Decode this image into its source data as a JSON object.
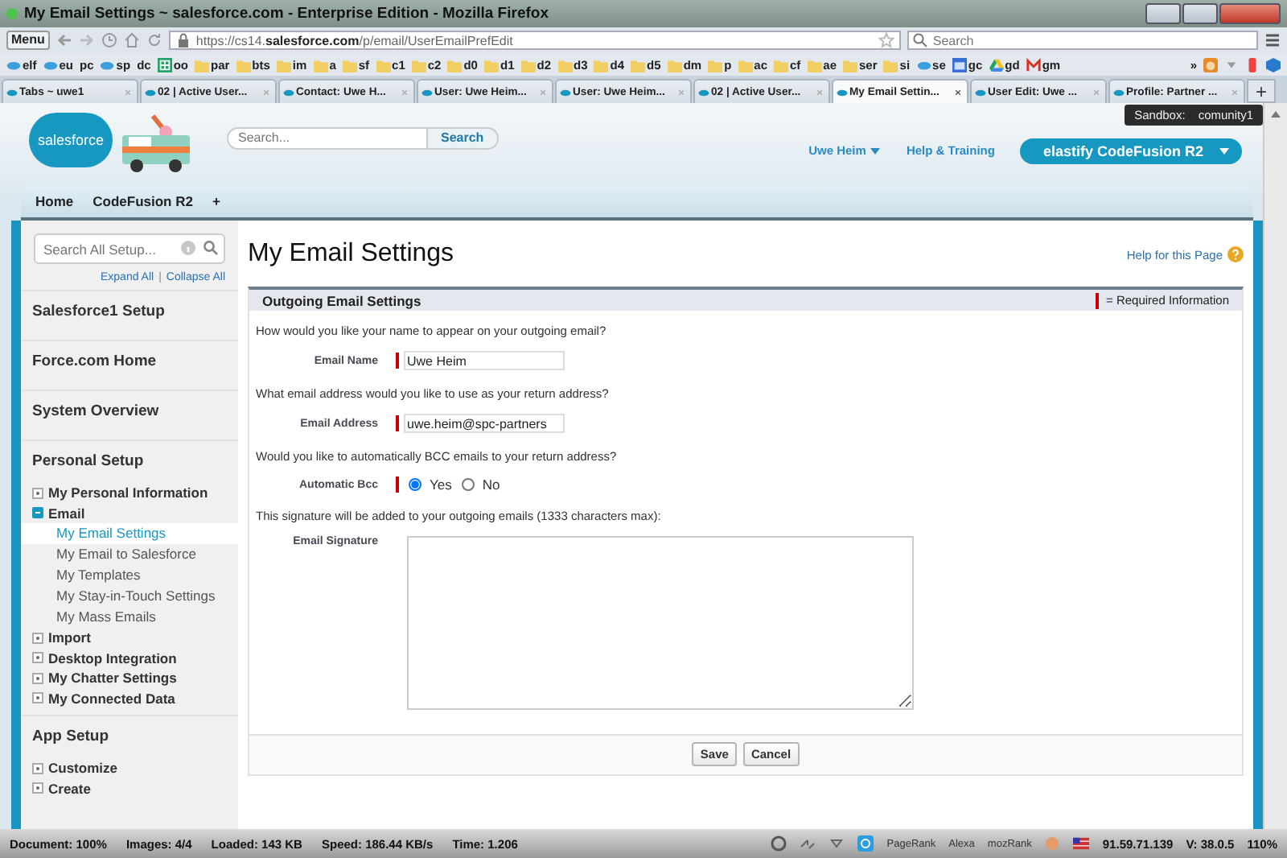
{
  "window": {
    "title": "My Email Settings ~ salesforce.com - Enterprise Edition - Mozilla Firefox"
  },
  "toolbar": {
    "menu": "Menu",
    "url": "https://cs14.**salesforce.com**/p/email/UserEmailPrefEdit",
    "search_placeholder": "Search"
  },
  "bookmarks": [
    {
      "label": "elf",
      "kind": "cloud"
    },
    {
      "label": "eu",
      "kind": "cloud"
    },
    {
      "label": "pc",
      "kind": "none"
    },
    {
      "label": "sp",
      "kind": "cloud"
    },
    {
      "label": "dc",
      "kind": "none"
    },
    {
      "label": "oo",
      "kind": "sheet"
    },
    {
      "label": "par",
      "kind": "folder"
    },
    {
      "label": "bts",
      "kind": "folder"
    },
    {
      "label": "im",
      "kind": "folder"
    },
    {
      "label": "a",
      "kind": "folder"
    },
    {
      "label": "sf",
      "kind": "folder"
    },
    {
      "label": "c1",
      "kind": "folder"
    },
    {
      "label": "c2",
      "kind": "folder"
    },
    {
      "label": "d0",
      "kind": "folder"
    },
    {
      "label": "d1",
      "kind": "folder"
    },
    {
      "label": "d2",
      "kind": "folder"
    },
    {
      "label": "d3",
      "kind": "folder"
    },
    {
      "label": "d4",
      "kind": "folder"
    },
    {
      "label": "d5",
      "kind": "folder"
    },
    {
      "label": "dm",
      "kind": "folder"
    },
    {
      "label": "p",
      "kind": "folder"
    },
    {
      "label": "ac",
      "kind": "folder"
    },
    {
      "label": "cf",
      "kind": "folder"
    },
    {
      "label": "ae",
      "kind": "folder"
    },
    {
      "label": "ser",
      "kind": "folder"
    },
    {
      "label": "si",
      "kind": "folder"
    },
    {
      "label": "se",
      "kind": "cloud"
    },
    {
      "label": "gc",
      "kind": "calendar"
    },
    {
      "label": "gd",
      "kind": "drive"
    },
    {
      "label": "gm",
      "kind": "mail"
    }
  ],
  "bookmarks_more": "»",
  "tabs": [
    {
      "label": "Tabs ~ uwe1",
      "selected": false
    },
    {
      "label": "02 | Active User...",
      "selected": false
    },
    {
      "label": "Contact: Uwe H...",
      "selected": false
    },
    {
      "label": "User: Uwe Heim...",
      "selected": false
    },
    {
      "label": "User: Uwe Heim...",
      "selected": false
    },
    {
      "label": "02 | Active User...",
      "selected": false
    },
    {
      "label": "My Email Settin...",
      "selected": true
    },
    {
      "label": "User Edit: Uwe ...",
      "selected": false
    },
    {
      "label": "Profile: Partner ...",
      "selected": false
    }
  ],
  "new_tab": "+",
  "sandbox": {
    "label": "Sandbox:",
    "value": "comunity1"
  },
  "header": {
    "logo": "salesforce",
    "search_placeholder": "Search...",
    "search_button": "Search",
    "user": "Uwe Heim",
    "help": "Help & Training",
    "org": "elastify CodeFusion R2"
  },
  "app_tabs": [
    {
      "label": "Home",
      "selected": false
    },
    {
      "label": "CodeFusion R2",
      "selected": false
    }
  ],
  "add_tab": "+",
  "sidebar": {
    "search_placeholder": "Search All Setup...",
    "expand_all": "Expand All",
    "separator": "|",
    "collapse_all": "Collapse All",
    "sections": [
      {
        "title": "Salesforce1 Setup"
      },
      {
        "title": "Force.com Home"
      },
      {
        "title": "System Overview"
      },
      {
        "title": "Personal Setup",
        "items": [
          {
            "label": "My Personal Information",
            "expanded": false
          },
          {
            "label": "Email",
            "expanded": true,
            "children": [
              {
                "label": "My Email Settings",
                "selected": true
              },
              {
                "label": "My Email to Salesforce",
                "selected": false
              },
              {
                "label": "My Templates",
                "selected": false
              },
              {
                "label": "My Stay-in-Touch Settings",
                "selected": false
              },
              {
                "label": "My Mass Emails",
                "selected": false
              }
            ]
          },
          {
            "label": "Import",
            "expanded": false
          },
          {
            "label": "Desktop Integration",
            "expanded": false
          },
          {
            "label": "My Chatter Settings",
            "expanded": false
          },
          {
            "label": "My Connected Data",
            "expanded": false
          }
        ]
      },
      {
        "title": "App Setup",
        "items": [
          {
            "label": "Customize",
            "expanded": false
          },
          {
            "label": "Create",
            "expanded": false
          }
        ]
      }
    ]
  },
  "page": {
    "title": "My Email Settings",
    "help": "Help for this Page",
    "section": "Outgoing Email Settings",
    "required_legend": "= Required Information",
    "form": [
      {
        "kind": "question",
        "text": "How would you like your name to appear on your outgoing email?"
      },
      {
        "kind": "text",
        "label": "Email Name",
        "value": "Uwe Heim",
        "required": true
      },
      {
        "kind": "question",
        "text": "What email address would you like to use as your return address?"
      },
      {
        "kind": "text",
        "label": "Email Address",
        "value": "uwe.heim@spc-partners",
        "required": true
      },
      {
        "kind": "question",
        "text": "Would you like to automatically BCC emails to your return address?"
      },
      {
        "kind": "radio",
        "label": "Automatic Bcc",
        "required": true,
        "options": [
          {
            "label": "Yes",
            "selected": true
          },
          {
            "label": "No",
            "selected": false
          }
        ]
      },
      {
        "kind": "question",
        "text": "This signature will be added to your outgoing emails (1333 characters max):"
      },
      {
        "kind": "textarea",
        "label": "Email Signature",
        "required": false
      }
    ],
    "buttons": [
      "Save",
      "Cancel"
    ]
  },
  "status_bar": {
    "items": [
      "Document: 100%",
      "Images: 4/4",
      "Loaded: 143 KB",
      "Speed: 186.44 KB/s",
      "Time: 1.206"
    ],
    "ranks": [
      "PageRank",
      "Alexa",
      "mozRank"
    ],
    "ip": "91.59.71.139",
    "version": "V: 38.0.5",
    "zoom": "110%"
  }
}
